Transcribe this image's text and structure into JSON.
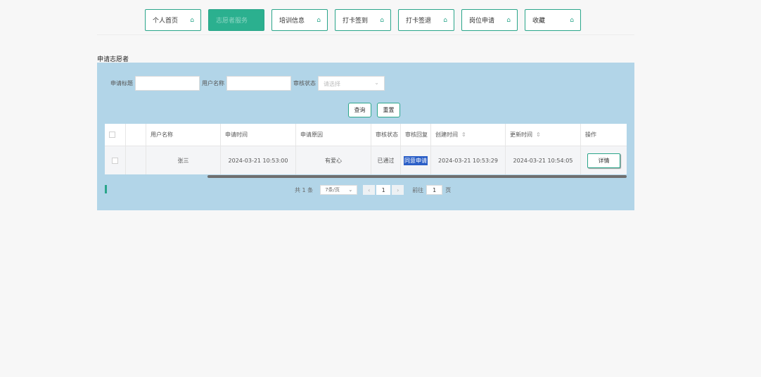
{
  "nav": {
    "items": [
      {
        "label": "个人首页",
        "icon": "home-icon",
        "active": false
      },
      {
        "label": "志愿者服务",
        "icon": "home-icon",
        "active": true
      },
      {
        "label": "培训信息",
        "icon": "home-icon",
        "active": false
      },
      {
        "label": "打卡签到",
        "icon": "home-icon",
        "active": false
      },
      {
        "label": "打卡签退",
        "icon": "home-icon",
        "active": false
      },
      {
        "label": "岗位申请",
        "icon": "home-icon",
        "active": false
      },
      {
        "label": "收藏",
        "icon": "home-icon",
        "active": false
      }
    ]
  },
  "page": {
    "title": "申请志愿者"
  },
  "filters": {
    "title_label": "申请标题",
    "username_label": "用户名称",
    "status_label": "审核状态",
    "status_placeholder": "请选择"
  },
  "buttons": {
    "search": "查询",
    "reset": "重置"
  },
  "table": {
    "headers": {
      "username": "用户名称",
      "apply_time": "申请时间",
      "reason": "申请原因",
      "status": "审核状态",
      "reply": "审核回复",
      "created": "创建时间",
      "updated": "更新时间",
      "actions": "操作"
    },
    "rows": [
      {
        "username": "张三",
        "apply_time": "2024-03-21 10:53:00",
        "reason": "有爱心",
        "status": "已通过",
        "reply": "同意申请",
        "created": "2024-03-21 10:53:29",
        "updated": "2024-03-21 10:54:05",
        "action": "详情"
      }
    ]
  },
  "pager": {
    "total": "共 1 条",
    "size": "7条/页",
    "current": "1",
    "goto_label": "前往",
    "goto_value": "1",
    "page_suffix": "页"
  },
  "colors": {
    "accent": "#2aa58a",
    "panel": "#b2d5e8",
    "selection": "#2b5fc7"
  }
}
